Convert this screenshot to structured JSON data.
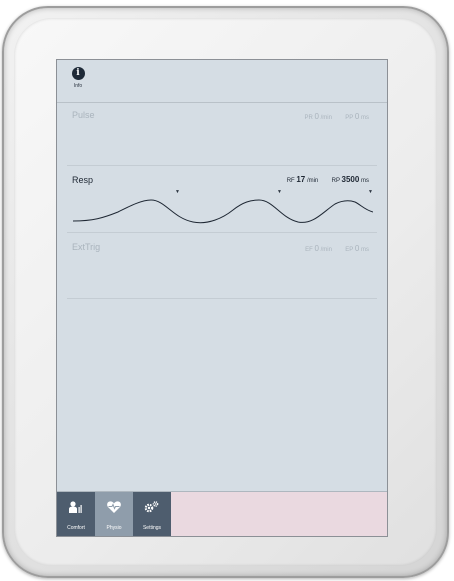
{
  "topbar": {
    "info_label": "Info"
  },
  "channels": [
    {
      "name": "Pulse",
      "metrics": [
        {
          "label": "PR",
          "value": "0",
          "unit": "/min"
        },
        {
          "label": "PP",
          "value": "0",
          "unit": "ms"
        }
      ]
    },
    {
      "name": "Resp",
      "metrics": [
        {
          "label": "RF",
          "value": "17",
          "unit": "/min"
        },
        {
          "label": "RP",
          "value": "3500",
          "unit": "ms"
        }
      ]
    },
    {
      "name": "ExtTrig",
      "metrics": [
        {
          "label": "EF",
          "value": "0",
          "unit": "/min"
        },
        {
          "label": "EP",
          "value": "0",
          "unit": "ms"
        }
      ]
    }
  ],
  "tabs": [
    {
      "label": "Comfort",
      "icon": "person-comfort-icon"
    },
    {
      "label": "Physio",
      "icon": "heart-pulse-icon"
    },
    {
      "label": "Settings",
      "icon": "gears-icon"
    }
  ],
  "colors": {
    "screen_bg": "#d5dde4",
    "tab_dark": "#4e5d6e",
    "tab_active": "#8f9dab",
    "status_area": "#ead9e0"
  }
}
